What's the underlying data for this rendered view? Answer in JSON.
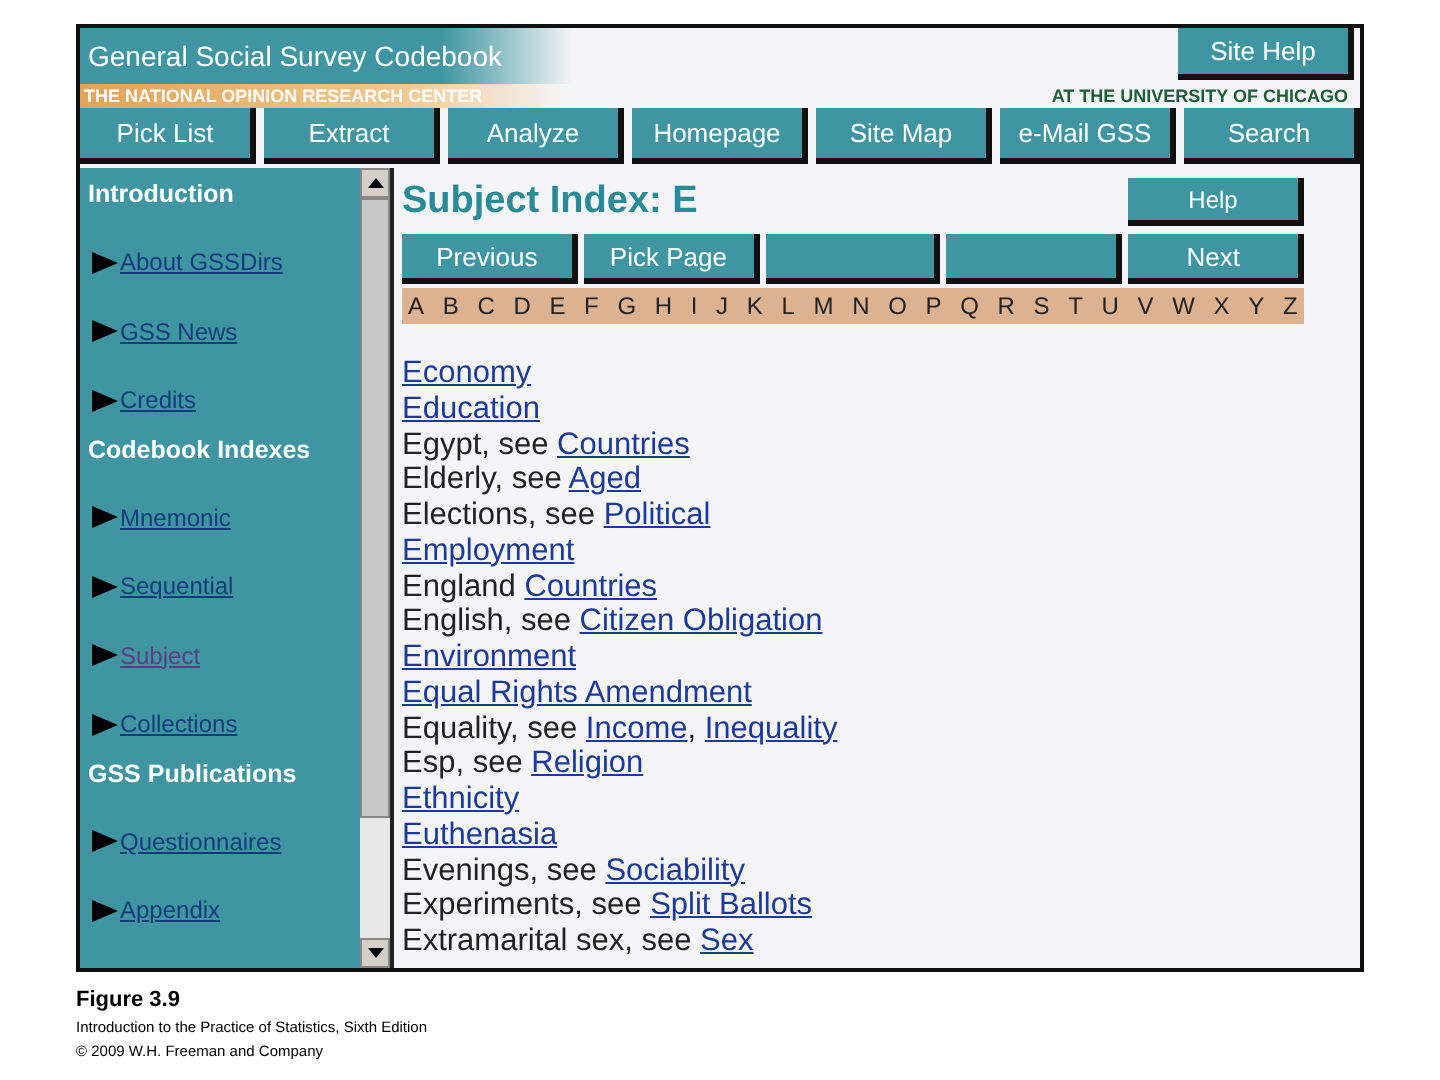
{
  "header": {
    "title": "General Social Survey Codebook",
    "help_button": "Site Help",
    "left_banner": "THE NATIONAL OPINION RESEARCH CENTER",
    "right_banner": "AT THE UNIVERSITY OF CHICAGO"
  },
  "nav": [
    "Pick List",
    "Extract",
    "Analyze",
    "Homepage",
    "Site Map",
    "e-Mail GSS",
    "Search"
  ],
  "sidebar": [
    {
      "kind": "heading",
      "label": "Introduction"
    },
    {
      "kind": "link",
      "label": "About GSSDirs",
      "visited": false
    },
    {
      "kind": "link",
      "label": "GSS News",
      "visited": false
    },
    {
      "kind": "link",
      "label": "Credits",
      "visited": false
    },
    {
      "kind": "heading",
      "label": "Codebook Indexes"
    },
    {
      "kind": "link",
      "label": "Mnemonic",
      "visited": false
    },
    {
      "kind": "link",
      "label": "Sequential",
      "visited": false
    },
    {
      "kind": "link",
      "label": "Subject",
      "visited": true
    },
    {
      "kind": "link",
      "label": "Collections",
      "visited": false
    },
    {
      "kind": "heading",
      "label": "GSS Publications"
    },
    {
      "kind": "link",
      "label": "Questionnaires",
      "visited": false
    },
    {
      "kind": "link",
      "label": "Appendix",
      "visited": false
    }
  ],
  "content": {
    "title": "Subject Index: E",
    "help_button": "Help",
    "pager": [
      {
        "kind": "button",
        "label": "Previous"
      },
      {
        "kind": "button",
        "label": "Pick Page"
      },
      {
        "kind": "blank"
      },
      {
        "kind": "blank"
      },
      {
        "kind": "button",
        "label": "Next"
      }
    ],
    "letters": [
      "A",
      "B",
      "C",
      "D",
      "E",
      "F",
      "G",
      "H",
      "I",
      "J",
      "K",
      "L",
      "M",
      "N",
      "O",
      "P",
      "Q",
      "R",
      "S",
      "T",
      "U",
      "V",
      "W",
      "X",
      "Y",
      "Z"
    ],
    "entries": [
      [
        {
          "text": "Economy",
          "link": true
        }
      ],
      [
        {
          "text": "Education",
          "link": true
        }
      ],
      [
        {
          "text": "Egypt, see ",
          "link": false
        },
        {
          "text": "Countries",
          "link": true
        }
      ],
      [
        {
          "text": "Elderly, see ",
          "link": false
        },
        {
          "text": "Aged",
          "link": true
        }
      ],
      [
        {
          "text": "Elections, see ",
          "link": false
        },
        {
          "text": "Political",
          "link": true
        }
      ],
      [
        {
          "text": "Employment",
          "link": true
        }
      ],
      [
        {
          "text": "England ",
          "link": false
        },
        {
          "text": "Countries",
          "link": true
        }
      ],
      [
        {
          "text": "English, see ",
          "link": false
        },
        {
          "text": "Citizen Obligation",
          "link": true
        }
      ],
      [
        {
          "text": "Environment",
          "link": true
        }
      ],
      [
        {
          "text": "Equal Rights Amendment",
          "link": true
        }
      ],
      [
        {
          "text": "Equality, see ",
          "link": false
        },
        {
          "text": "Income",
          "link": true
        },
        {
          "text": ", ",
          "link": false
        },
        {
          "text": "Inequality",
          "link": true
        }
      ],
      [
        {
          "text": "Esp, see ",
          "link": false
        },
        {
          "text": "Religion",
          "link": true
        }
      ],
      [
        {
          "text": "Ethnicity",
          "link": true
        }
      ],
      [
        {
          "text": "Euthenasia",
          "link": true
        }
      ],
      [
        {
          "text": "Evenings, see ",
          "link": false
        },
        {
          "text": "Sociability",
          "link": true
        }
      ],
      [
        {
          "text": "Experiments, see ",
          "link": false
        },
        {
          "text": "Split Ballots",
          "link": true
        }
      ],
      [
        {
          "text": "Extramarital sex, see ",
          "link": false
        },
        {
          "text": "Sex",
          "link": true
        }
      ]
    ]
  },
  "caption": {
    "figure": "Figure 3.9",
    "book": "Introduction to the Practice of Statistics, Sixth Edition",
    "copyright": "© 2009 W.H. Freeman and Company"
  }
}
